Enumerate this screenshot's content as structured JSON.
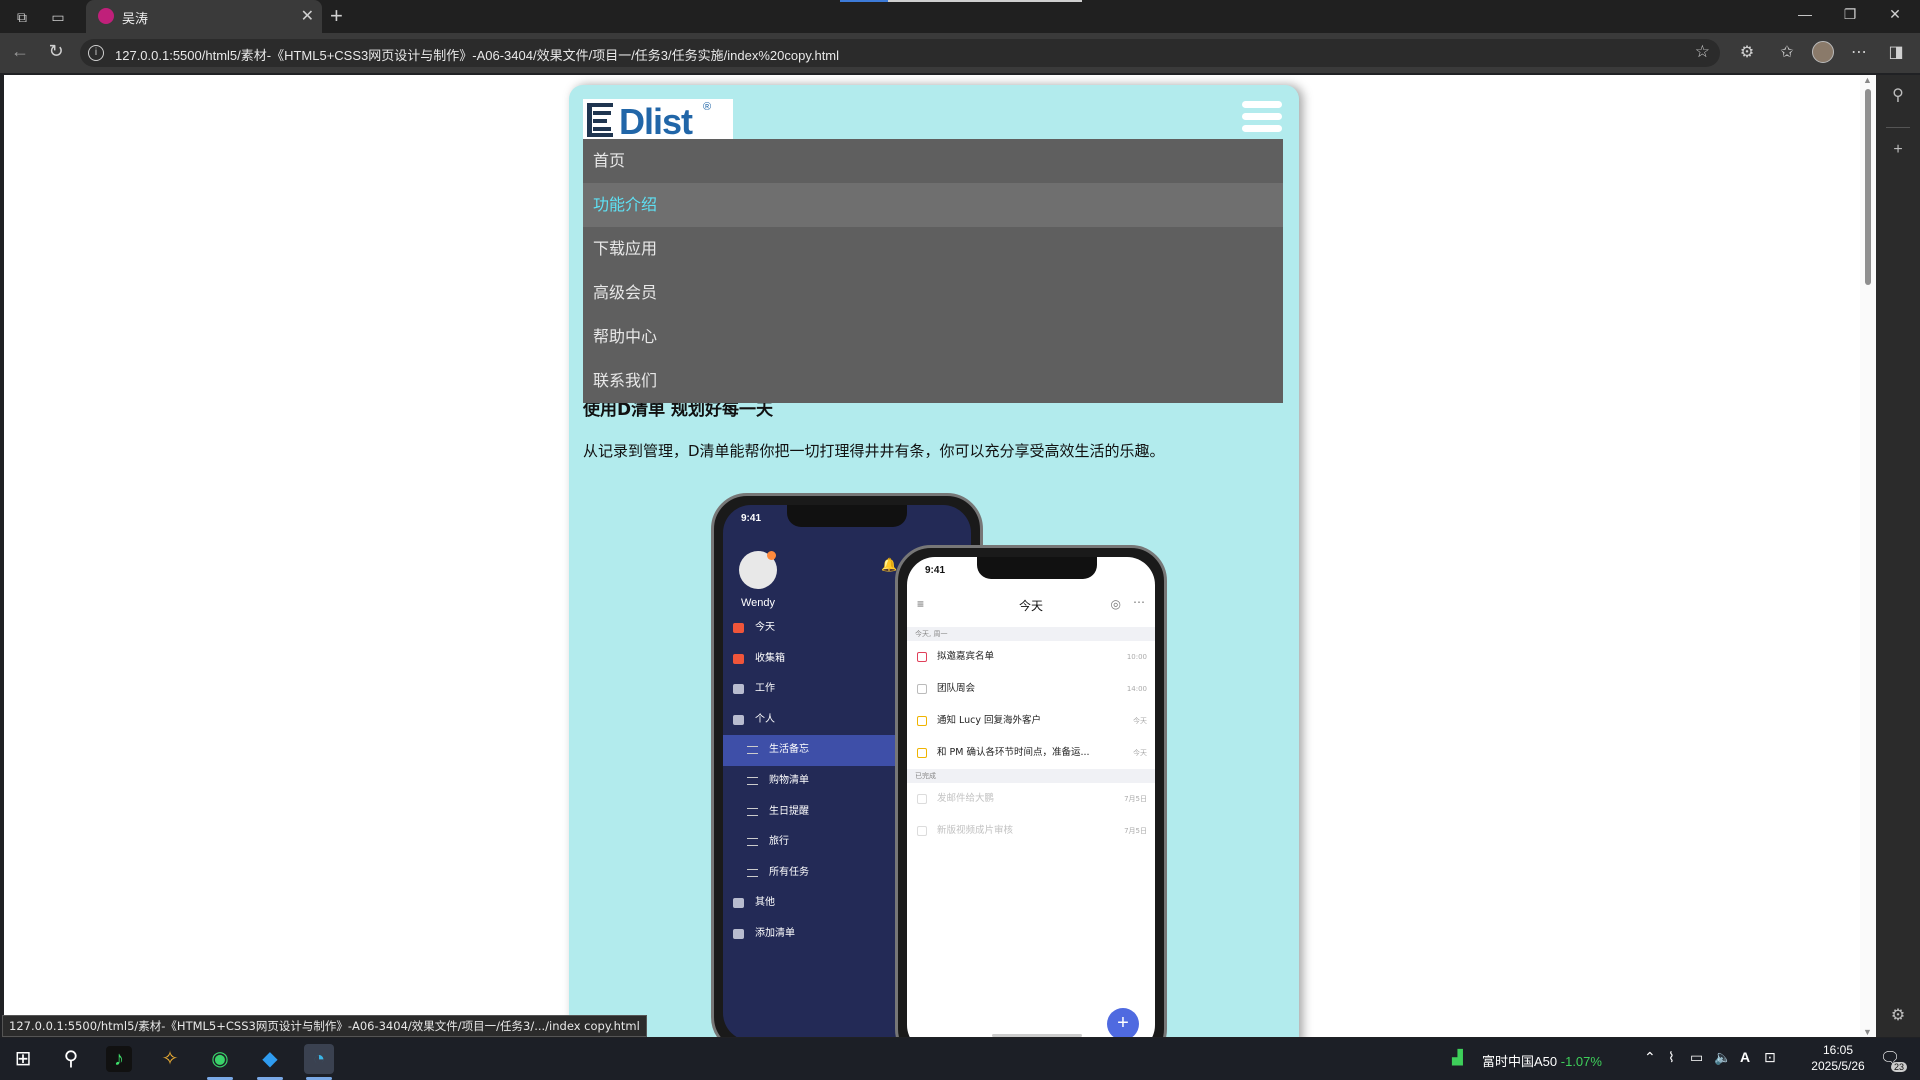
{
  "browser": {
    "tab_title": "吴涛",
    "url": "127.0.0.1:5500/html5/素材-《HTML5+CSS3网页设计与制作》-A06-3404/效果文件/项目一/任务3/任务实施/index%20copy.html",
    "status_url": "127.0.0.1:5500/html5/素材-《HTML5+CSS3网页设计与制作》-A06-3404/效果文件/项目一/任务3/.../index copy.html"
  },
  "page": {
    "logo_text": "Dlist",
    "logo_reg": "®",
    "menu": [
      {
        "label": "首页",
        "active": false
      },
      {
        "label": "功能介绍",
        "active": true
      },
      {
        "label": "下载应用",
        "active": false
      },
      {
        "label": "高级会员",
        "active": false
      },
      {
        "label": "帮助中心",
        "active": false
      },
      {
        "label": "联系我们",
        "active": false
      }
    ],
    "hero_title": "使用D清单 规划好每一天",
    "hero_desc": "从记录到管理，D清单能帮你把一切打理得井井有条，你可以充分享受高效生活的乐趣。",
    "phone1": {
      "time": "9:41",
      "user": "Wendy",
      "items": [
        {
          "label": "今天",
          "icon_color": "#f0553a",
          "sub": false,
          "selected": false
        },
        {
          "label": "收集箱",
          "icon_color": "#f0553a",
          "sub": false,
          "selected": false
        },
        {
          "label": "工作",
          "icon_color": "#b8bccf",
          "sub": false,
          "selected": false
        },
        {
          "label": "个人",
          "icon_color": "#b8bccf",
          "sub": false,
          "selected": false
        },
        {
          "label": "生活备忘",
          "icon_color": "#ffffff",
          "sub": true,
          "selected": true
        },
        {
          "label": "购物清单",
          "icon_color": "#ffffff",
          "sub": true,
          "selected": false
        },
        {
          "label": "生日提醒",
          "icon_color": "#ffffff",
          "sub": true,
          "selected": false
        },
        {
          "label": "旅行",
          "icon_color": "#ffffff",
          "sub": true,
          "selected": false
        },
        {
          "label": "所有任务",
          "icon_color": "#ffffff",
          "sub": true,
          "selected": false
        },
        {
          "label": "其他",
          "icon_color": "#b8bccf",
          "sub": false,
          "selected": false
        },
        {
          "label": "添加清单",
          "icon_color": "#b8bccf",
          "sub": false,
          "selected": false
        }
      ]
    },
    "phone2": {
      "time": "9:41",
      "title": "今天",
      "section_today": "今天, 周一",
      "section_done": "已完成",
      "tasks": [
        {
          "label": "拟邀嘉宾名单",
          "time": "10:00",
          "box_color": "#e0405a"
        },
        {
          "label": "团队周会",
          "time": "14:00",
          "box_color": "#bbbbbb"
        },
        {
          "label": "通知 Lucy 回复海外客户",
          "time": "今天",
          "box_color": "#f0b400"
        },
        {
          "label": "和 PM 确认各环节时间点，准备运...",
          "time": "今天",
          "box_color": "#f0b400"
        }
      ],
      "done_tasks": [
        {
          "label": "发邮件给大鹏",
          "time": "7月5日"
        },
        {
          "label": "新版视频成片审核",
          "time": "7月5日"
        }
      ],
      "fab": "+"
    }
  },
  "taskbar": {
    "stock_name": "富时中国A50",
    "stock_change": "-1.07%",
    "time": "16:05",
    "date": "2025/5/26",
    "notif_count": "23",
    "ime": "A"
  },
  "colors": {
    "card_bg": "#b2ebed",
    "menu_bg": "#5f5f5f",
    "menu_active": "#5ee2f5",
    "logo_blue": "#2166a8"
  }
}
